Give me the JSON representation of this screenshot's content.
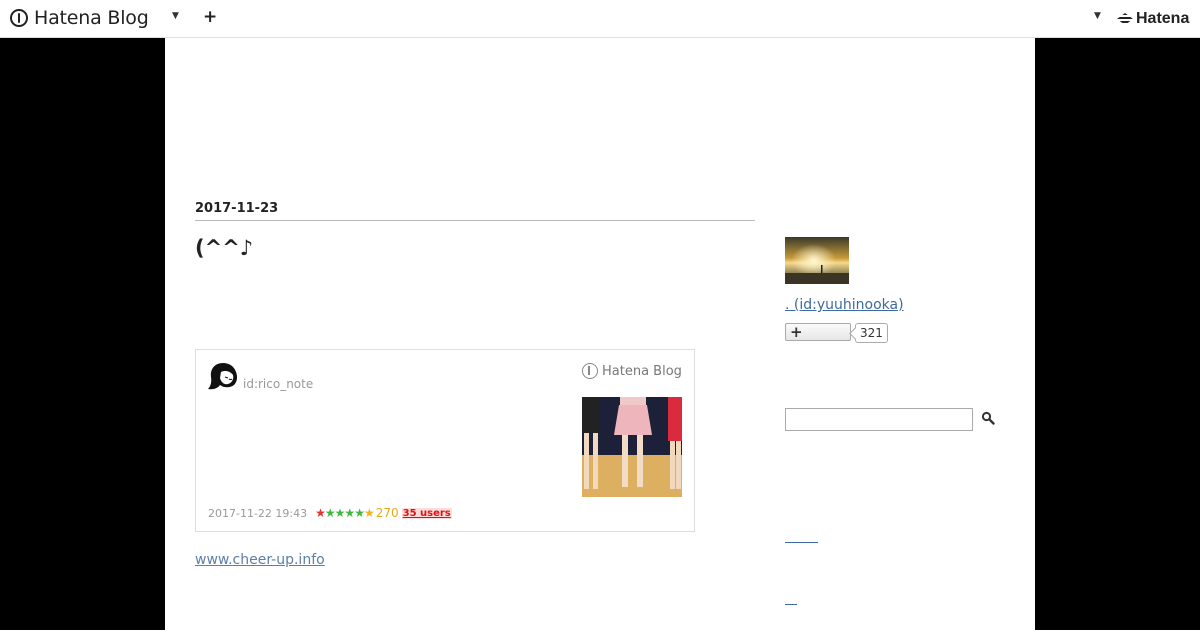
{
  "header": {
    "logo_text": "Hatena Blog",
    "right_logo_text": "Hatena"
  },
  "entry": {
    "date": "2017-11-23",
    "title": "(^^♪",
    "embed": {
      "author": "id:rico_note",
      "brand": "Hatena Blog",
      "timestamp": "2017-11-22 19:43",
      "star_count": "270",
      "users": "35 users"
    },
    "source_link": "www.cheer-up.info"
  },
  "sidebar": {
    "profile_name": ". (id:yuuhinooka)",
    "subscriber_count": "321",
    "search": {
      "placeholder": ""
    }
  },
  "colors": {
    "link": "#3d6aa0",
    "background": "#000000",
    "star_colors": [
      "#e33333",
      "#41b641",
      "#41b641",
      "#41b641",
      "#41b641",
      "#f2b31b"
    ]
  }
}
